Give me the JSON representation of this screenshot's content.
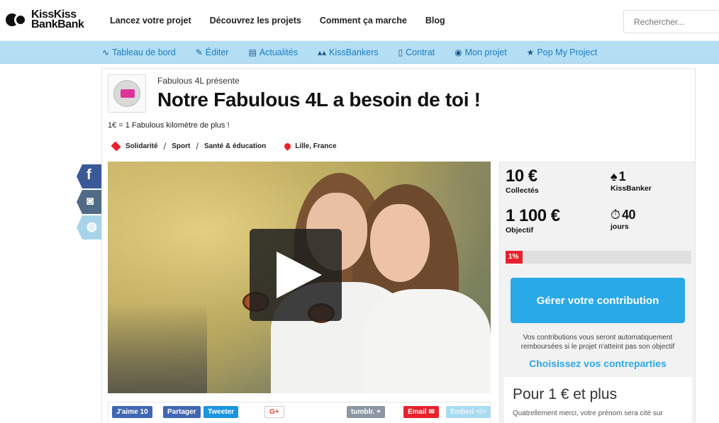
{
  "header": {
    "logo_text": "Kiss Kiss Bank Bank",
    "logo_line1": "KissKiss",
    "logo_line2": "BankBank",
    "nav": [
      "Lancez votre projet",
      "Découvrez les projets",
      "Comment ça marche",
      "Blog"
    ],
    "search_placeholder": "Rechercher..."
  },
  "subnav": {
    "items": [
      {
        "icon": "pulse-icon",
        "label": "Tableau de bord"
      },
      {
        "icon": "pencil-icon",
        "label": "Éditer"
      },
      {
        "icon": "newspaper-icon",
        "label": "Actualités"
      },
      {
        "icon": "people-icon",
        "label": "KissBankers"
      },
      {
        "icon": "document-icon",
        "label": "Contrat"
      },
      {
        "icon": "eye-icon",
        "label": "Mon projet"
      },
      {
        "icon": "star-icon",
        "label": "Pop My Project"
      }
    ]
  },
  "project": {
    "presents": "Fabulous 4L présente",
    "title": "Notre Fabulous 4L a besoin de toi !",
    "tagline": "1€ = 1 Fabulous kilomètre de plus !",
    "categories": [
      "Solidarité",
      "Sport",
      "Santé & éducation"
    ],
    "separator": "/",
    "location": "Lille, France"
  },
  "social": {
    "facebook": "f",
    "instagram": "◙",
    "website": "◍"
  },
  "share": {
    "like": "J'aime 10",
    "share": "Partager",
    "tweet": "Tweeter",
    "gplus": "G+",
    "tumblr": "tumblr. +",
    "email": "Email ✉",
    "embed": "Embed </>"
  },
  "stats": {
    "collected_value": "10 €",
    "collected_label": "Collectés",
    "backers_value": "1",
    "backers_label": "KissBanker",
    "goal_value": "1 100 €",
    "goal_label": "Objectif",
    "days_value": "40",
    "days_label": "jours",
    "progress_label": "1%",
    "progress_percent": 1
  },
  "cta": {
    "manage": "Gérer votre contribution",
    "note": "Vos contributions vous seront automatiquement remboursées si le projet n'atteint pas son objectif",
    "choose": "Choisissez vos contreparties"
  },
  "reward": {
    "title": "Pour 1 € et plus",
    "description": "Quatrellement merci, votre prénom sera cité sur"
  },
  "colors": {
    "accent": "#29a9e6",
    "danger": "#e8212b",
    "subnav_bg": "#b3def3"
  }
}
